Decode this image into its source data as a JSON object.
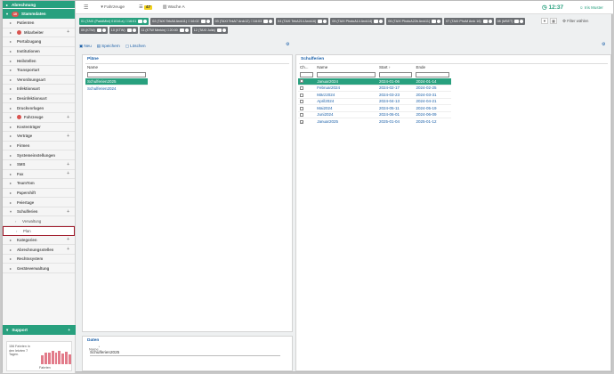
{
  "sidebar": {
    "top_item": "Abrechnung",
    "section": {
      "badge": "10",
      "label": "Stammdaten"
    },
    "items": [
      {
        "label": "Patienten",
        "plus": false
      },
      {
        "label": "Mitarbeiter",
        "plus": true,
        "red": true
      },
      {
        "label": "Portalzugang",
        "plus": false
      },
      {
        "label": "Institutionen",
        "plus": false
      },
      {
        "label": "Heilstellen",
        "plus": false
      },
      {
        "label": "Transportart",
        "plus": false
      },
      {
        "label": "Verordnungsart",
        "plus": false
      },
      {
        "label": "Infektionsart",
        "plus": false
      },
      {
        "label": "Desinfektionsart",
        "plus": false
      },
      {
        "label": "Druckvorlagen",
        "plus": false
      },
      {
        "label": "Fahrzeuge",
        "plus": true,
        "red": true
      },
      {
        "label": "Kostenträger",
        "plus": false
      },
      {
        "label": "Verträge",
        "plus": true
      },
      {
        "label": "Firmen",
        "plus": false
      },
      {
        "label": "Systemeinstellungen",
        "plus": false
      },
      {
        "label": "SMS",
        "plus": true
      },
      {
        "label": "Fax",
        "plus": true
      },
      {
        "label": "TeamTom",
        "plus": false
      },
      {
        "label": "Papershift",
        "plus": false
      },
      {
        "label": "Feiertage",
        "plus": false
      },
      {
        "label": "Schulferien",
        "plus": true,
        "open": true
      },
      {
        "label": "Verwaltung",
        "sub": true
      },
      {
        "label": "Plan",
        "sub": true,
        "selected": true
      },
      {
        "label": "Kategorien",
        "plus": true
      },
      {
        "label": "Abrechnungsstellen",
        "plus": true
      },
      {
        "label": "Rechtssystem",
        "plus": false
      },
      {
        "label": "Geräteverwaltung",
        "plus": false
      }
    ],
    "support": "Support",
    "stats": {
      "text": "156 Fahrten in den letzten 7 Tagen.",
      "caption": "Fahrten",
      "bars": [
        0.55,
        0.75,
        0.7,
        0.85,
        0.7,
        0.85,
        0.65,
        0.8,
        0.6
      ]
    }
  },
  "topbar": {
    "vehicles": "Fahrzeuge",
    "count": "47",
    "wache": "Wache A",
    "clock": "12:37",
    "user": "Iris Muster"
  },
  "vehicles": [
    {
      "label": "01 (TAXI (PaddMini) 01016.a) ☐16:01",
      "active": true
    },
    {
      "label": "02 (TAXI TekA6 Arck11) ☐16:02"
    },
    {
      "label": "03 (TAXI TekA7 Arck12) ☐16:03"
    },
    {
      "label": "04 (TAXI TekA214 Arck16)"
    },
    {
      "label": "05 (TAXI PhotoA14 Arck14)"
    },
    {
      "label": "06 (TAXI PhotoA22b Arck11)"
    },
    {
      "label": "07 (TAXI PhoM Arck 16)"
    },
    {
      "label": "08 (MSET)"
    },
    {
      "label": "09 (KTW)"
    },
    {
      "label": "10 (KTW)"
    },
    {
      "label": "11 (KTW Merkin) ☐20:00"
    },
    {
      "label": "12 (TAXI Julia)"
    }
  ],
  "filter": {
    "label": "Filter wählen"
  },
  "toolbar": {
    "new": "Neu",
    "save": "Speichern",
    "delete": "Löschen"
  },
  "plaene": {
    "title": "Pläne",
    "column": "Name",
    "rows": [
      "Schulferien2025",
      "Schulferien2024"
    ]
  },
  "schulferien": {
    "title": "Schulferien",
    "columns": {
      "check": "Ch...",
      "name": "Name",
      "start": "Start",
      "end": "Ende"
    },
    "rows": [
      {
        "name": "Januar2024",
        "start": "2024-01-06",
        "end": "2024-01-14",
        "checked": false,
        "selected": true
      },
      {
        "name": "Februar2024",
        "start": "2024-02-17",
        "end": "2024-02-25",
        "checked": false
      },
      {
        "name": "März2024",
        "start": "2024-03-23",
        "end": "2024-03-31",
        "checked": false
      },
      {
        "name": "April2024",
        "start": "2024-04-13",
        "end": "2024-04-21",
        "checked": false
      },
      {
        "name": "Mai2024",
        "start": "2024-05-11",
        "end": "2024-05-19",
        "checked": false
      },
      {
        "name": "Juni2024",
        "start": "2024-06-01",
        "end": "2024-06-09",
        "checked": false
      },
      {
        "name": "Januar2025",
        "start": "2025-01-04",
        "end": "2025-01-12",
        "checked": true
      }
    ]
  },
  "daten": {
    "title": "Daten",
    "field_label": "Name",
    "field_value": "Schulferien2025"
  },
  "colors": {
    "accent": "#28a07e",
    "link": "#1a5fa8",
    "alert": "#d9534f",
    "selected_border": "#a01a2a"
  }
}
